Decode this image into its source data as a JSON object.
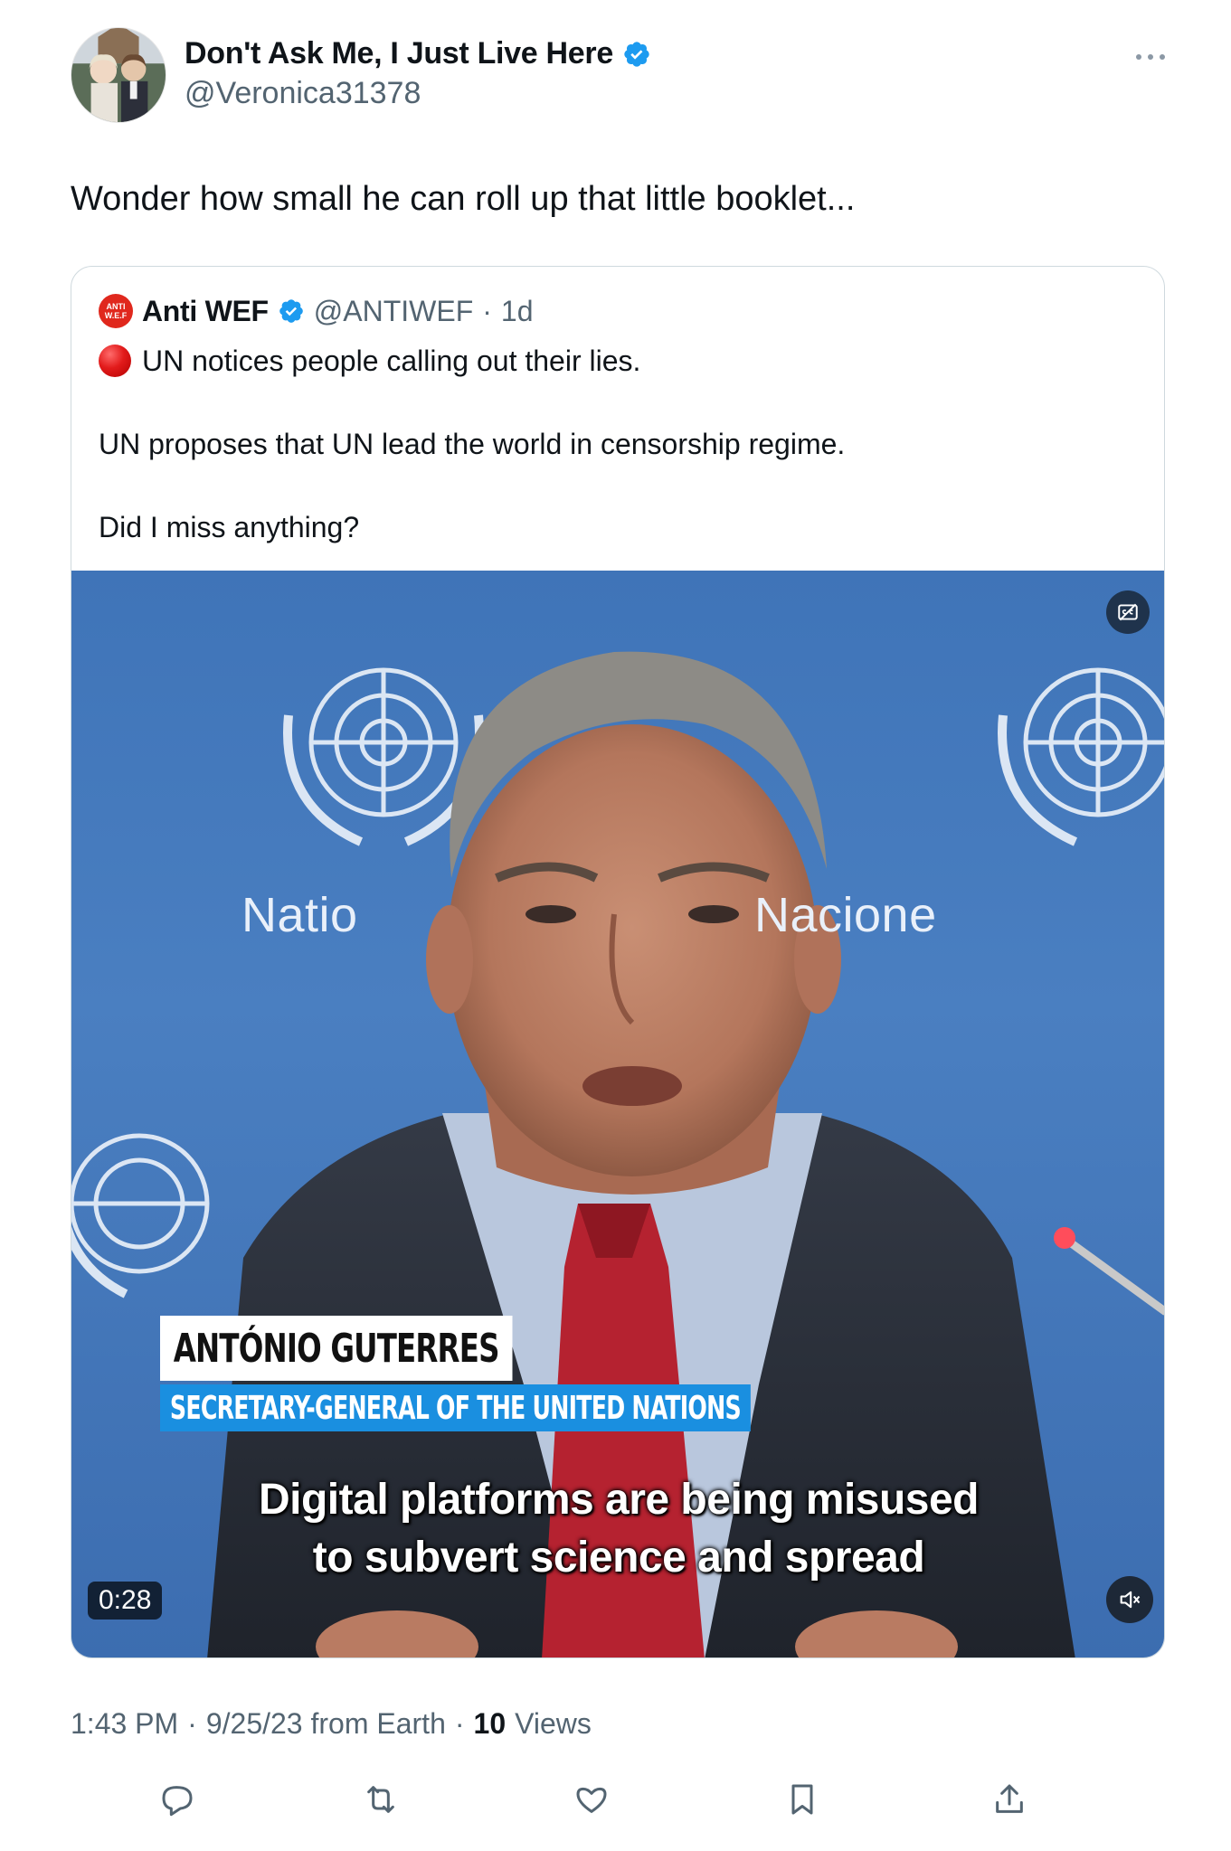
{
  "author": {
    "name": "Don't Ask Me, I Just Live Here",
    "handle": "@Veronica31378"
  },
  "tweet": {
    "text": "Wonder how small he can roll up that little booklet..."
  },
  "quote": {
    "avatar_text_line1": "ANTI",
    "avatar_text_line2": "W.E.F",
    "name": "Anti WEF",
    "handle": "@ANTIWEF",
    "separator": "·",
    "time": "1d",
    "line1": "UN notices people calling out their lies.",
    "line2": "UN proposes that UN lead the world in censorship regime.",
    "line3": "Did I miss anything?"
  },
  "video": {
    "bg_text_left": "Natio",
    "bg_text_right": "Nacione",
    "lower_third_name": "ANTÓNIO  GUTERRES",
    "lower_third_title": "SECRETARY-GENERAL OF THE UNITED NATIONS",
    "subtitle_line1": "Digital platforms are being misused",
    "subtitle_line2": "to subvert science and spread",
    "duration": "0:28"
  },
  "meta": {
    "time": "1:43 PM",
    "sep1": "·",
    "date_source": "9/25/23 from Earth",
    "sep2": "·",
    "views_count": "10",
    "views_label": "Views"
  },
  "icons": {
    "verified": "verified-badge-icon",
    "more": "more-icon",
    "reply": "reply-icon",
    "retweet": "retweet-icon",
    "like": "like-icon",
    "bookmark": "bookmark-icon",
    "share": "share-icon",
    "captions": "captions-icon",
    "mute": "mute-icon"
  },
  "colors": {
    "verified_blue": "#1d9bf0",
    "secondary_text": "#536471",
    "lower_third_blue": "#1a8fe0",
    "video_background": "#3f74b8"
  }
}
